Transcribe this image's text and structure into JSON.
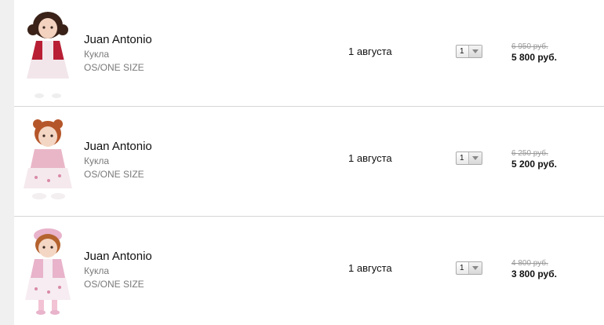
{
  "items": [
    {
      "brand": "Juan Antonio",
      "type": "Кукла",
      "size": "OS/ONE SIZE",
      "delivery": "1 августа",
      "quantity": "1",
      "old_price": "6 950 руб.",
      "price": "5 800 руб.",
      "colors": {
        "hair": "#3a2218",
        "jacket": "#b81f35",
        "dress": "#f2e6ea"
      }
    },
    {
      "brand": "Juan Antonio",
      "type": "Кукла",
      "size": "OS/ONE SIZE",
      "delivery": "1 августа",
      "quantity": "1",
      "old_price": "6 250 руб.",
      "price": "5 200 руб.",
      "colors": {
        "hair": "#b5562a",
        "jacket": "#e9b6c8",
        "dress": "#f5e9ee"
      }
    },
    {
      "brand": "Juan Antonio",
      "type": "Кукла",
      "size": "OS/ONE SIZE",
      "delivery": "1 августа",
      "quantity": "1",
      "old_price": "4 800 руб.",
      "price": "3 800 руб.",
      "colors": {
        "hair": "#b4622e",
        "jacket": "#e8b3cb",
        "dress": "#f6ecf1"
      }
    }
  ]
}
